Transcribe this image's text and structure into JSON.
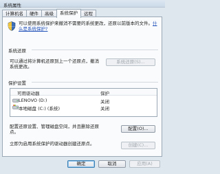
{
  "window": {
    "title": "系统属性"
  },
  "tabs": [
    {
      "label": "计算机名"
    },
    {
      "label": "硬件"
    },
    {
      "label": "高级"
    },
    {
      "label": "系统保护"
    },
    {
      "label": "远程"
    }
  ],
  "active_tab": "系统保护",
  "intro": {
    "text": "可以使用系统保护来撤消不需要的系统更改，还原以前版本的文件。",
    "link": "什么是系统保护?"
  },
  "system_restore": {
    "title": "系统还原",
    "text": "可以通过将计算机还原到上一个还原点，撤消系统更改。",
    "button": "系统还原(S)..."
  },
  "protection": {
    "title": "保护设置",
    "columns": [
      "可用驱动器",
      "保护"
    ],
    "drives": [
      {
        "name": "LENOVO (D:)",
        "status": "关闭",
        "icon": "drive-icon"
      },
      {
        "name": "本地磁盘 (C:) (系统)",
        "status": "关闭",
        "icon": "system-drive-icon"
      }
    ],
    "config_text": "配置还原设置、管理磁盘空间，并且删除还原点。",
    "config_button": "配置(O)...",
    "create_text": "立即为启用系统保护的驱动器创建还原点。",
    "create_button": "创建(C)..."
  },
  "footer": {
    "ok": "确定",
    "cancel": "取消",
    "apply": "应用(A)"
  }
}
